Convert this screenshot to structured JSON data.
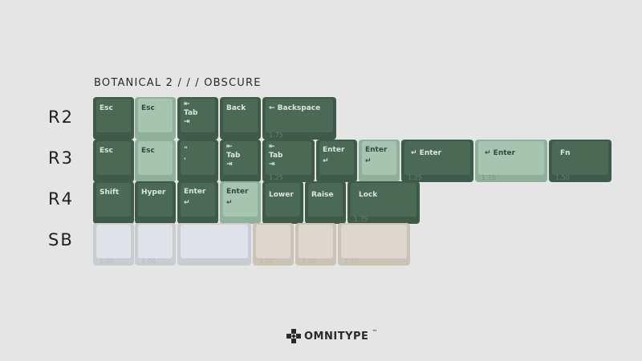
{
  "title": "BOTANICAL 2 / / / OBSCURE",
  "rows": [
    "R2",
    "R3",
    "R4",
    "SB"
  ],
  "colors": {
    "dark_green": "#4b6a55",
    "light_green": "#a6c5b0",
    "white": "#dfe2e6",
    "beige": "#ddd8cd"
  },
  "keys": {
    "r2": [
      {
        "legend": "Esc",
        "sub": ""
      },
      {
        "legend": "Esc",
        "sub": ""
      },
      {
        "legend": "⇤\nTab\n⇥",
        "sub": ""
      },
      {
        "legend": "Back",
        "sub": ""
      },
      {
        "legend": "← Backspace",
        "sub": "1.75"
      }
    ],
    "r3": [
      {
        "legend": "Esc",
        "sub": ""
      },
      {
        "legend": "Esc",
        "sub": ""
      },
      {
        "legend": "\"\n'",
        "sub": ""
      },
      {
        "legend": "⇤\nTab\n⇥",
        "sub": ""
      },
      {
        "legend": "⇤\nTab\n⇥",
        "sub": "1.25"
      },
      {
        "legend": "Enter\n↵",
        "sub": ""
      },
      {
        "legend": "Enter\n↵",
        "sub": ""
      },
      {
        "legend": "↵ Enter",
        "sub": "1.25"
      },
      {
        "legend": "↵ Enter",
        "sub": "1.75"
      },
      {
        "legend": "Fn",
        "sub": "1.50"
      }
    ],
    "r4": [
      {
        "legend": "Shift",
        "sub": ""
      },
      {
        "legend": "Hyper",
        "sub": ""
      },
      {
        "legend": "Enter\n↵",
        "sub": ""
      },
      {
        "legend": "Enter\n↵",
        "sub": ""
      },
      {
        "legend": "Lower",
        "sub": ""
      },
      {
        "legend": "Raise",
        "sub": ""
      },
      {
        "legend": "Lock",
        "sub": "1.75"
      }
    ],
    "sb": [
      {
        "legend": "",
        "sub": "1.00"
      },
      {
        "legend": "",
        "sub": "1.00"
      },
      {
        "legend": "",
        "sub": ""
      },
      {
        "legend": "",
        "sub": "1.00"
      },
      {
        "legend": "",
        "sub": "1.00"
      },
      {
        "legend": "",
        "sub": "1.75"
      }
    ]
  },
  "logo": {
    "text": "OMNITYPE",
    "trademark": "™"
  }
}
